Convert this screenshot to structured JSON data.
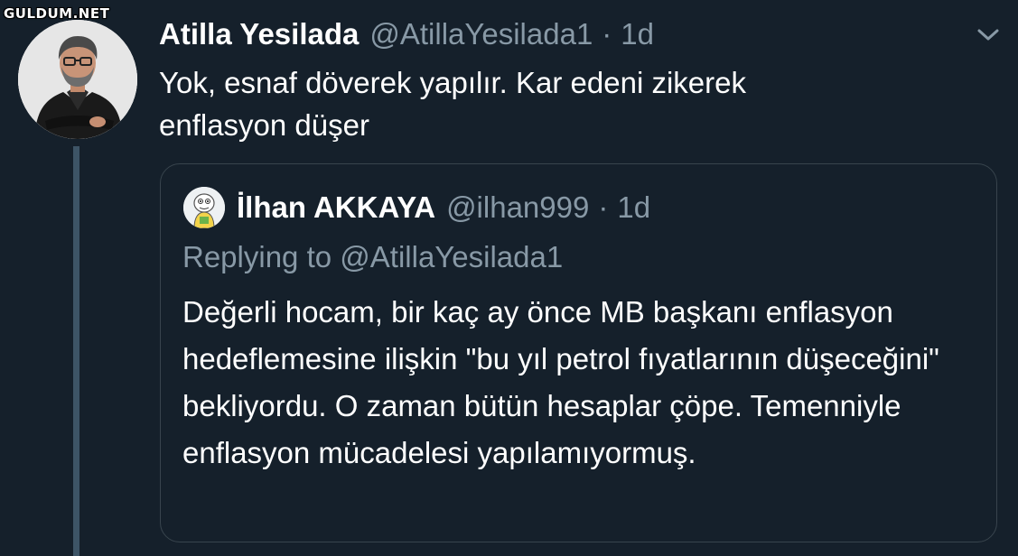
{
  "watermark": "GULDUM.NET",
  "tweet": {
    "author_name": "Atilla Yesilada",
    "author_handle": "@AtillaYesilada1",
    "separator": "·",
    "timestamp": "1d",
    "text": "Yok, esnaf döverek yapılır.  Kar edeni zikerek\nenflasyon düşer",
    "menu_icon": "chevron-down-icon",
    "avatar_icon": "profile-photo-man-in-black-suit"
  },
  "quoted_tweet": {
    "author_name": "İlhan AKKAYA",
    "author_handle": "@ilhan999",
    "separator": "·",
    "timestamp": "1d",
    "replying_to": "Replying to @AtillaYesilada1",
    "text": "Değerli hocam, bir kaç ay önce MB başkanı enflasyon hedeflemesine ilişkin \"bu yıl petrol fıyatlarının düşeceğini\" bekliyordu. O zaman bütün hesaplar çöpe. Temenniyle enflasyon mücadelesi yapılamıyormuş.",
    "avatar_icon": "cartoon-avatar-icon"
  },
  "colors": {
    "background": "#15202b",
    "text_primary": "#ffffff",
    "text_secondary": "#8899a6",
    "border": "#38444d",
    "thread_line": "#3d5466"
  }
}
